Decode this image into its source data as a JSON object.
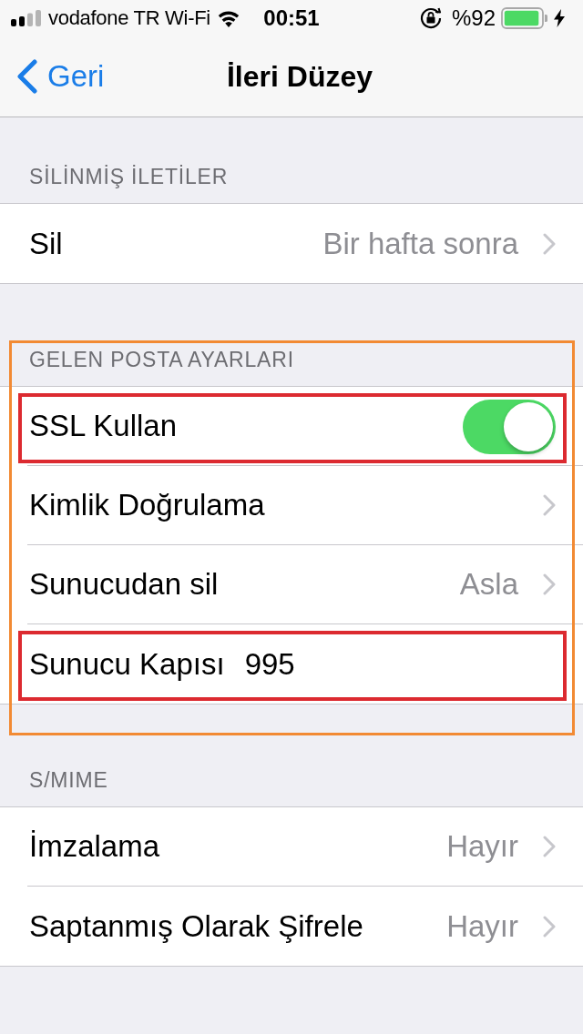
{
  "status_bar": {
    "carrier": "vodafone TR Wi-Fi",
    "time": "00:51",
    "battery_percent": "%92",
    "charging": true
  },
  "nav_bar": {
    "back_label": "Geri",
    "title": "İleri Düzey"
  },
  "sections": [
    {
      "header": "SİLİNMİŞ İLETİLER",
      "outlined": false,
      "rows": [
        {
          "kind": "disclosure",
          "label": "Sil",
          "value": "Bir hafta sonra",
          "highlighted": false
        }
      ]
    },
    {
      "header": "GELEN POSTA AYARLARI",
      "outlined": true,
      "rows": [
        {
          "kind": "toggle",
          "label": "SSL Kullan",
          "on": true,
          "highlighted": true
        },
        {
          "kind": "disclosure",
          "label": "Kimlik Doğrulama",
          "highlighted": false
        },
        {
          "kind": "disclosure",
          "label": "Sunucudan sil",
          "value": "Asla",
          "highlighted": false
        },
        {
          "kind": "field",
          "label": "Sunucu Kapısı",
          "value": "995",
          "highlighted": true
        }
      ]
    },
    {
      "header": "S/MIME",
      "outlined": false,
      "rows": [
        {
          "kind": "disclosure",
          "label": "İmzalama",
          "value": "Hayır",
          "highlighted": false
        },
        {
          "kind": "disclosure",
          "label": "Saptanmış Olarak Şifrele",
          "value": "Hayır",
          "highlighted": false
        }
      ]
    }
  ]
}
